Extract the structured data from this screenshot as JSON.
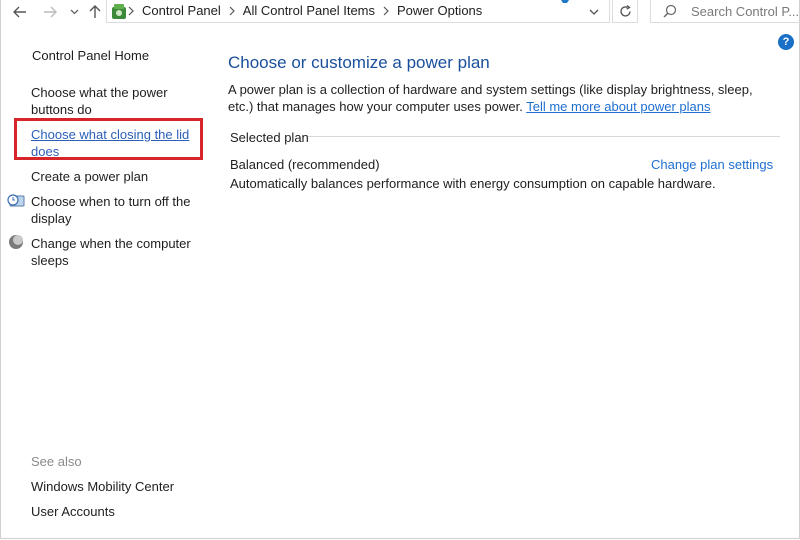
{
  "address_bar": {
    "breadcrumbs": [
      "Control Panel",
      "All Control Panel Items",
      "Power Options"
    ],
    "search_placeholder": "Search Control P..."
  },
  "sidebar": {
    "home": "Control Panel Home",
    "links": [
      {
        "label": "Choose what the power buttons do"
      },
      {
        "label": "Choose what closing the lid does"
      },
      {
        "label": "Create a power plan"
      },
      {
        "label": "Choose when to turn off the display"
      },
      {
        "label": "Change when the computer sleeps"
      }
    ],
    "see_also": "See also",
    "see_also_links": [
      "Windows Mobility Center",
      "User Accounts"
    ]
  },
  "main": {
    "title": "Choose or customize a power plan",
    "description": "A power plan is a collection of hardware and system settings (like display brightness, sleep, etc.) that manages how your computer uses power.",
    "learn_more": "Tell me more about power plans",
    "selected_plan_label": "Selected plan",
    "plan_name": "Balanced (recommended)",
    "change_plan_link": "Change plan settings",
    "plan_description": "Automatically balances performance with energy consumption on capable hardware."
  },
  "help_icon": "?",
  "colors": {
    "title": "#1a4f9c",
    "link": "#1f6fd1",
    "highlight_box": "#d6262a"
  }
}
